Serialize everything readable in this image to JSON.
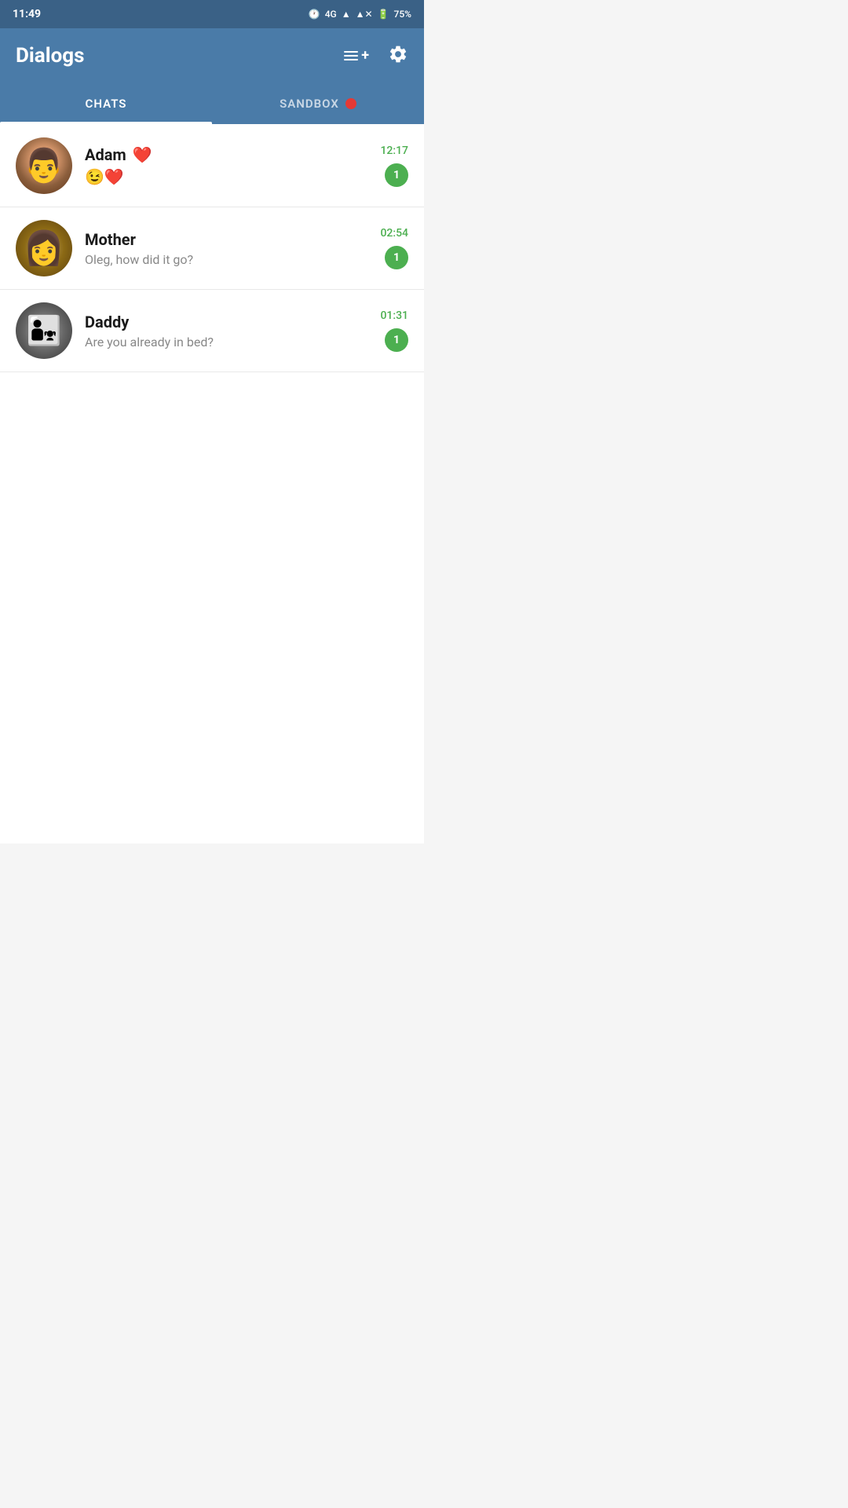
{
  "statusBar": {
    "time": "11:49",
    "signal": "4G",
    "battery": "75%"
  },
  "header": {
    "title": "Dialogs",
    "newChatIcon": "new-chat-icon",
    "settingsIcon": "gear-icon"
  },
  "tabs": [
    {
      "id": "chats",
      "label": "CHATS",
      "active": true,
      "badge": null
    },
    {
      "id": "sandbox",
      "label": "SANDBOX",
      "active": false,
      "badge": "red-dot"
    }
  ],
  "chats": [
    {
      "id": "adam",
      "name": "Adam",
      "nameEmoji": "❤️",
      "lastMessage": "😉❤️",
      "time": "12:17",
      "unread": 1,
      "avatarLabel": "adam-avatar"
    },
    {
      "id": "mother",
      "name": "Mother",
      "nameEmoji": "",
      "lastMessage": "Oleg, how did it go?",
      "time": "02:54",
      "unread": 1,
      "avatarLabel": "mother-avatar"
    },
    {
      "id": "daddy",
      "name": "Daddy",
      "nameEmoji": "",
      "lastMessage": "Are you already in bed?",
      "time": "01:31",
      "unread": 1,
      "avatarLabel": "daddy-avatar"
    }
  ]
}
